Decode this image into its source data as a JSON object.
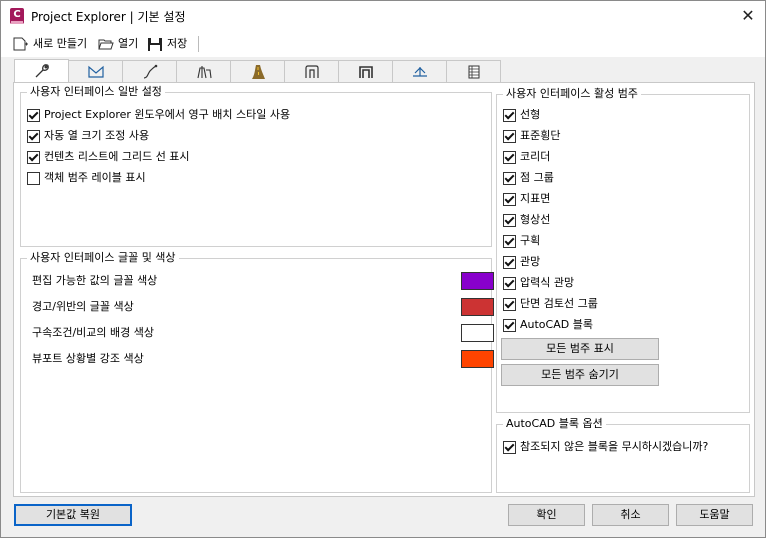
{
  "window": {
    "title": "Project Explorer | 기본 설정",
    "icon_letter": "C",
    "close_glyph": "✕"
  },
  "toolbar": {
    "new_label": "새로 만들기",
    "open_label": "열기",
    "save_label": "저장"
  },
  "tabs": [
    {
      "icon": "wrench-icon"
    },
    {
      "icon": "surface-icon"
    },
    {
      "icon": "alignment-icon"
    },
    {
      "icon": "structure-icon"
    },
    {
      "icon": "road-icon"
    },
    {
      "icon": "pipe-network-icon"
    },
    {
      "icon": "pressure-network-icon"
    },
    {
      "icon": "profile-icon"
    },
    {
      "icon": "table-icon"
    }
  ],
  "general_settings": {
    "title": "사용자 인터페이스 일반 설정",
    "options": [
      {
        "label": "Project Explorer 윈도우에서 영구 배치 스타일 사용",
        "checked": true
      },
      {
        "label": "자동 열 크기 조정 사용",
        "checked": true
      },
      {
        "label": "컨텐츠 리스트에 그리드 선 표시",
        "checked": true
      },
      {
        "label": "객체 범주 레이블 표시",
        "checked": false
      }
    ]
  },
  "fonts_colors": {
    "title": "사용자 인터페이스 글꼴 및 색상",
    "rows": [
      {
        "label": "편집 가능한 값의 글꼴 색상",
        "color": "#8800cc"
      },
      {
        "label": "경고/위반의 글꼴 색상",
        "color": "#cc3333"
      },
      {
        "label": "구속조건/비교의 배경 색상",
        "color": "#ffffff"
      },
      {
        "label": "뷰포트 상황별 강조 색상",
        "color": "#ff4400"
      }
    ]
  },
  "categories": {
    "title": "사용자 인터페이스 활성 범주",
    "items": [
      {
        "label": "선형",
        "checked": true
      },
      {
        "label": "표준횡단",
        "checked": true
      },
      {
        "label": "코리더",
        "checked": true
      },
      {
        "label": "점 그룹",
        "checked": true
      },
      {
        "label": "지표면",
        "checked": true
      },
      {
        "label": "형상선",
        "checked": true
      },
      {
        "label": "구획",
        "checked": true
      },
      {
        "label": "관망",
        "checked": true
      },
      {
        "label": "압력식 관망",
        "checked": true
      },
      {
        "label": "단면 검토선 그룹",
        "checked": true
      },
      {
        "label": "AutoCAD 블록",
        "checked": true
      }
    ],
    "show_all_label": "모든 범주 표시",
    "hide_all_label": "모든 범주 숨기기"
  },
  "block_options": {
    "title": "AutoCAD 블록 옵션",
    "option": {
      "label": "참조되지 않은 블록을 무시하시겠습니까?",
      "checked": true
    }
  },
  "footer": {
    "restore_label": "기본값 복원",
    "ok_label": "확인",
    "cancel_label": "취소",
    "help_label": "도움말"
  }
}
